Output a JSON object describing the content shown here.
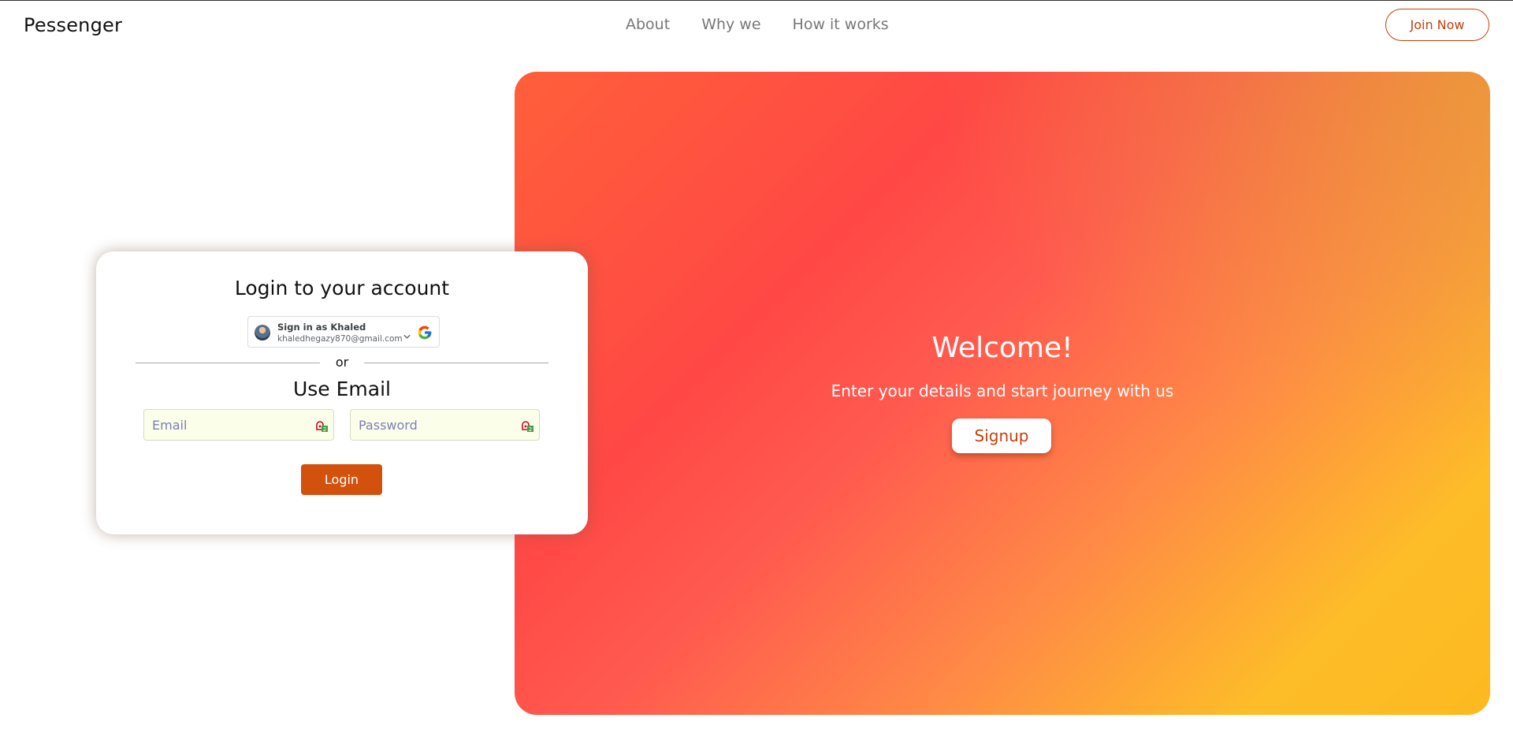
{
  "header": {
    "brand": "Pessenger",
    "nav": [
      "About",
      "Why we",
      "How it works"
    ],
    "join_label": "Join Now"
  },
  "login": {
    "title": "Login to your account",
    "google": {
      "name_line": "Sign in as Khaled",
      "email": "khaledhegazy870@gmail.com"
    },
    "or_label": "or",
    "use_email_title": "Use Email",
    "email_placeholder": "Email",
    "password_placeholder": "Password",
    "login_label": "Login"
  },
  "hero": {
    "welcome": "Welcome!",
    "subtitle": "Enter your details and start journey with us",
    "signup_label": "Signup"
  },
  "colors": {
    "accent": "#d2520d",
    "accent_text": "#c2410c",
    "field_bg": "#fbffea"
  }
}
